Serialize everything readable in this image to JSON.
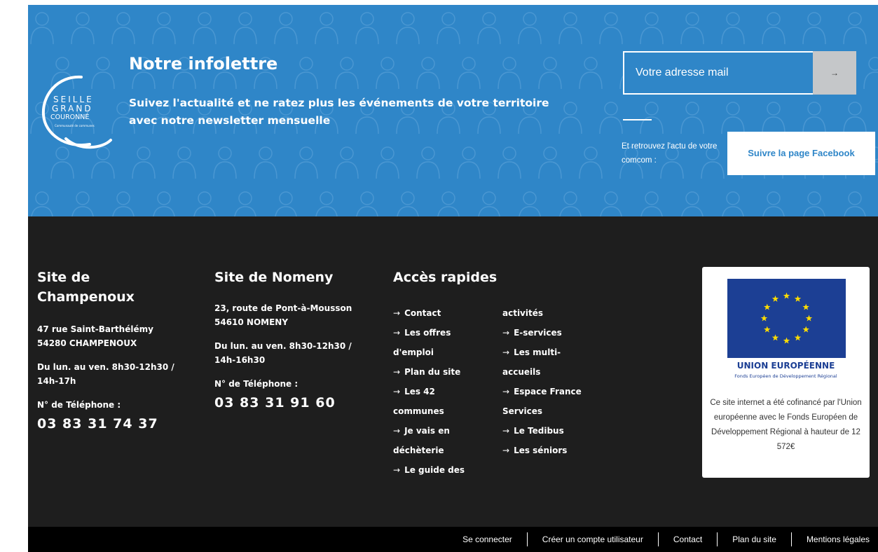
{
  "newsletter": {
    "logo": {
      "line1": "SEILLE",
      "line2": "GRAND",
      "line3": "COURONNÉ",
      "line4": "Communauté de communes"
    },
    "title": "Notre infolettre",
    "description": "Suivez l'actualité et ne ratez plus les événements de votre territoire avec notre newsletter mensuelle",
    "email_placeholder": "Votre adresse mail",
    "submit_arrow": "→",
    "facebook_prompt": "Et retrouvez l'actu de votre comcom :",
    "facebook_button": "Suivre la page Facebook",
    "colors": {
      "band": "#2f86c8",
      "button": "#c5c7c9"
    }
  },
  "footer": {
    "champenoux": {
      "title": "Site de Champenoux",
      "address_line1": "47 rue Saint-Barthélémy",
      "address_line2": "54280 CHAMPENOUX",
      "hours": "Du lun. au ven. 8h30-12h30 / 14h-17h",
      "phone_label": "N° de Téléphone :",
      "phone": "03 83 31 74 37"
    },
    "nomeny": {
      "title": "Site de Nomeny",
      "address_line1": "23, route de Pont-à-Mousson",
      "address_line2": "54610 NOMENY",
      "hours": "Du lun. au ven. 8h30-12h30 / 14h-16h30",
      "phone_label": "N° de Téléphone :",
      "phone": "03 83 31 91 60"
    },
    "quick_access": {
      "title": "Accès rapides",
      "arrow": "→",
      "col1": {
        "contact": "Contact",
        "offres": "Les offres",
        "offres_cont": "d'emploi",
        "plan": "Plan du site",
        "communes": "Les 42",
        "communes_cont": "communes",
        "dechet": "Je vais en",
        "dechet_cont": "déchèterie",
        "guide": "Le guide des"
      },
      "col2": {
        "guide_cont": "activités",
        "eservices": "E-services",
        "multi": "Les multi-",
        "multi_cont": "accueils",
        "espace": "Espace France",
        "espace_cont": "Services",
        "tedibus": "Le Tedibus",
        "seniors": "Les séniors"
      }
    },
    "eu": {
      "title": "UNION EUROPÉENNE",
      "subtitle": "Fonds Européen de Développement Régional",
      "text": "Ce site internet a été cofinancé par l'Union européenne avec le Fonds Européen de Développement Régional à hauteur de 12 572€",
      "flag_color": "#1c3f94",
      "star_color": "#ffdd00"
    },
    "background": "#1e1e1e"
  },
  "bottom_bar": {
    "login": "Se connecter",
    "create": "Créer un compte utilisateur",
    "contact": "Contact",
    "plan": "Plan du site",
    "legal": "Mentions légales"
  }
}
